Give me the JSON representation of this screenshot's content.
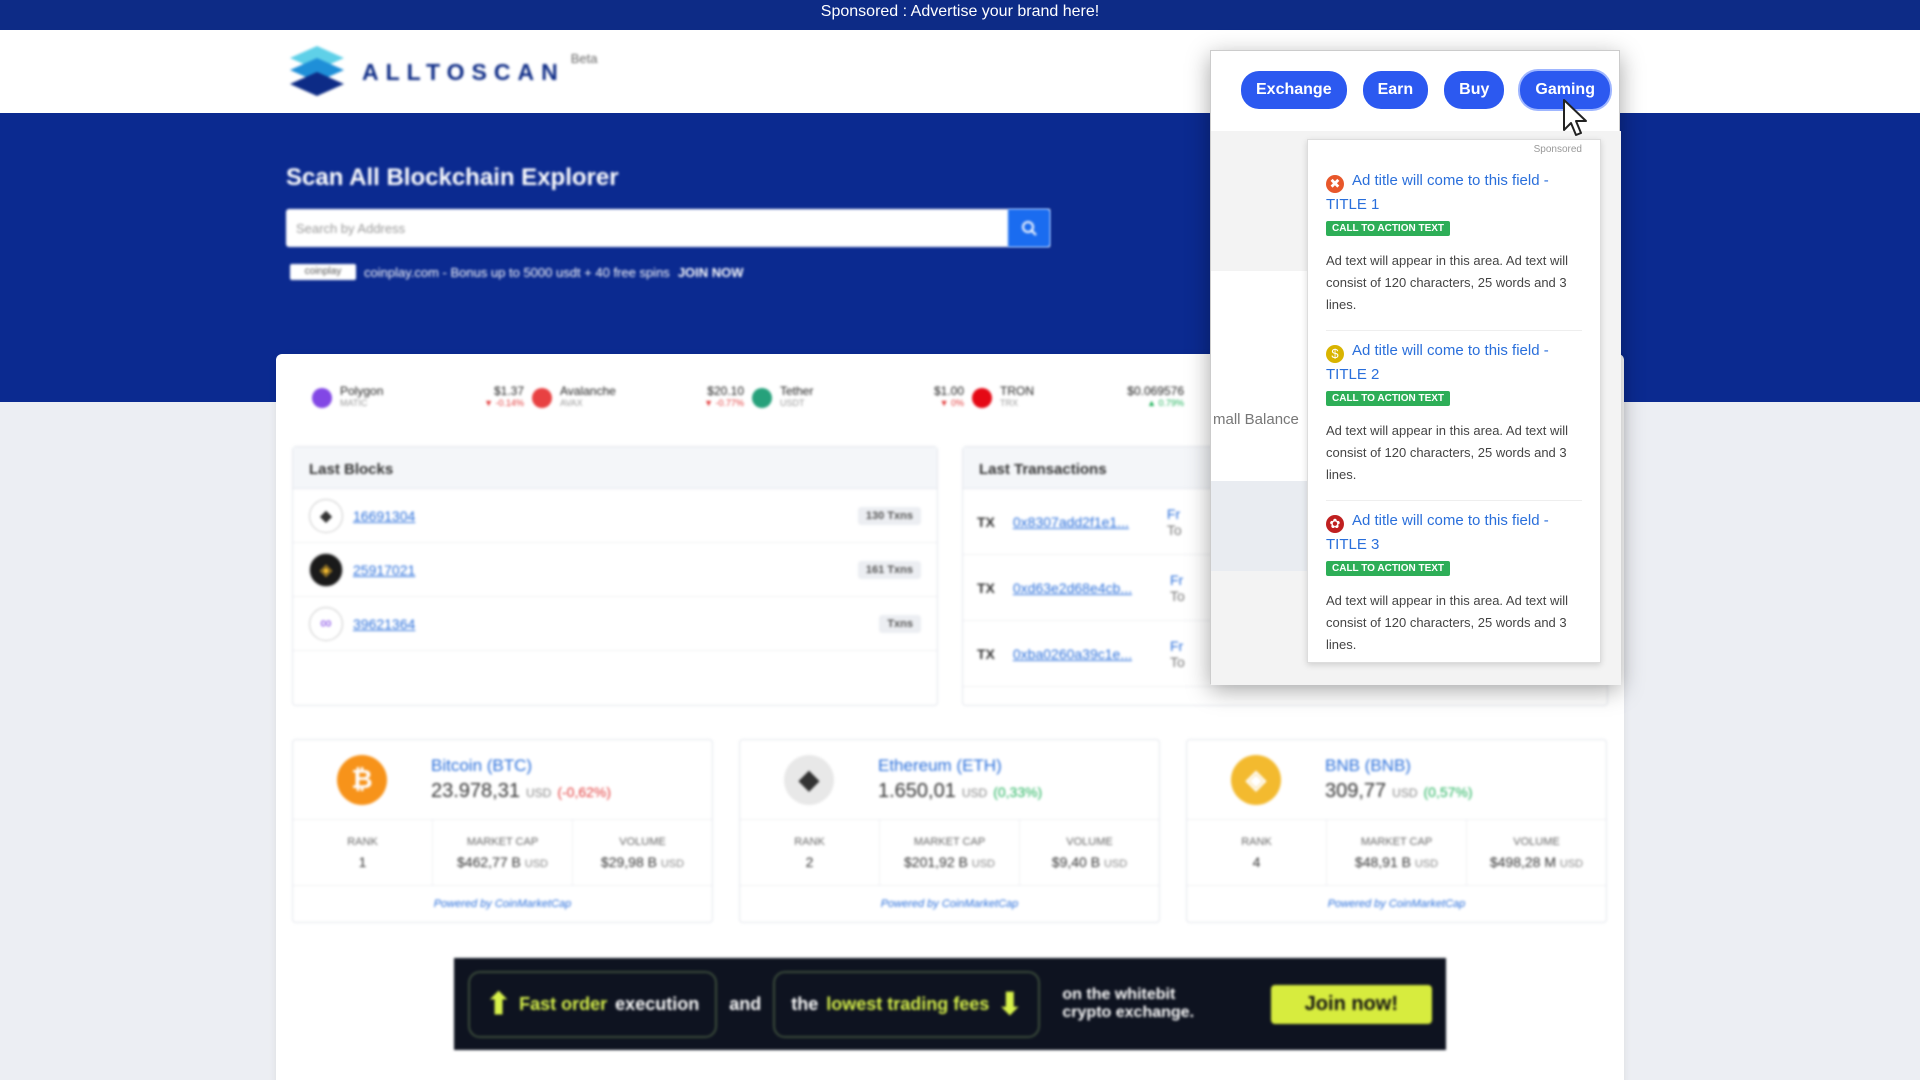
{
  "topbar": {
    "text": "Sponsored :  Advertise your brand here!"
  },
  "logo": {
    "text": "ALLTOSCAN",
    "beta": "Beta"
  },
  "hero": {
    "title": "Scan All Blockchain Explorer",
    "search_placeholder": "Search by Address",
    "promo_logo": "coinplay",
    "promo_text": "coinplay.com - Bonus up to 5000 usdt + 40 free spins",
    "promo_cta": "JOIN NOW"
  },
  "ticker": [
    {
      "name": "Polygon",
      "symbol": "MATIC",
      "price": "$1.37",
      "change": "▼ -0.14%",
      "color": "#8247e5",
      "dir": "down"
    },
    {
      "name": "Avalanche",
      "symbol": "AVAX",
      "price": "$20.10",
      "change": "▼ -0.77%",
      "color": "#e84142",
      "dir": "down"
    },
    {
      "name": "Tether",
      "symbol": "USDT",
      "price": "$1.00",
      "change": "▼ 0%",
      "color": "#26a17b",
      "dir": "down"
    },
    {
      "name": "TRON",
      "symbol": "TRX",
      "price": "$0.069576",
      "change": "▲ 0.79%",
      "color": "#e50915",
      "dir": "up"
    }
  ],
  "last_blocks": {
    "title": "Last Blocks",
    "rows": [
      {
        "block": "16691304",
        "txns": "130 Txns",
        "coin": "ethereum-icon"
      },
      {
        "block": "25917021",
        "txns": "161 Txns",
        "coin": "bnb-icon"
      },
      {
        "block": "39621364",
        "txns": "Txns",
        "coin": "polygon-icon"
      }
    ]
  },
  "last_transactions": {
    "title": "Last Transactions",
    "rows": [
      {
        "label": "TX",
        "hash": "0x8307add2f1e1...",
        "from": "Fr",
        "to": "To"
      },
      {
        "label": "TX",
        "hash": "0xd63e2d68e4cb...",
        "from": "Fr",
        "to": "To"
      },
      {
        "label": "TX",
        "hash": "0xba0260a39c1e...",
        "from": "Fr",
        "to": "To"
      }
    ]
  },
  "coins": [
    {
      "name": "Bitcoin (BTC)",
      "price": "23.978,31",
      "unit": "USD",
      "change": "(-0,62%)",
      "dir": "down",
      "rank_label": "RANK",
      "rank": "1",
      "mcap_label": "MARKET CAP",
      "mcap": "$462,77 B",
      "vol_label": "VOLUME",
      "vol": "$29,98 B",
      "powered": "Powered by CoinMarketCap",
      "color": "#f7931a",
      "glyph": "₿"
    },
    {
      "name": "Ethereum (ETH)",
      "price": "1.650,01",
      "unit": "USD",
      "change": "(0,33%)",
      "dir": "up",
      "rank_label": "RANK",
      "rank": "2",
      "mcap_label": "MARKET CAP",
      "mcap": "$201,92 B",
      "vol_label": "VOLUME",
      "vol": "$9,40 B",
      "powered": "Powered by CoinMarketCap",
      "color": "#e8e8e8",
      "glyph": "◆"
    },
    {
      "name": "BNB (BNB)",
      "price": "309,77",
      "unit": "USD",
      "change": "(0,57%)",
      "dir": "up",
      "rank_label": "RANK",
      "rank": "4",
      "mcap_label": "MARKET CAP",
      "mcap": "$48,91 B",
      "vol_label": "VOLUME",
      "vol": "$498,28 M",
      "powered": "Powered by CoinMarketCap",
      "color": "#f3ba2f",
      "glyph": "◈"
    }
  ],
  "coin_units": {
    "usd": "USD"
  },
  "banner": {
    "part1_hl": "Fast order",
    "part1": "execution",
    "and": "and",
    "part2_pre": "the",
    "part2_hl": "lowest trading fees",
    "tail1": "on the",
    "brand": "whitebit",
    "tail2": "crypto exchange.",
    "cta": "Join now!"
  },
  "popup": {
    "buttons": [
      "Exchange",
      "Earn",
      "Buy",
      "Gaming"
    ],
    "active_button": "Gaming",
    "side_text": "mall Balance",
    "sponsored": "Sponsored",
    "ads": [
      {
        "title": "Ad title will come to this field - TITLE 1",
        "cta": "CALL TO ACTION TEXT",
        "desc": "Ad text will appear in this area. Ad text will consist of 120 characters, 25 words and 3 lines.",
        "icon": "x-icon",
        "icon_color": "#e8572a",
        "glyph": "✖"
      },
      {
        "title": "Ad title will come to this field - TITLE 2",
        "cta": "CALL TO ACTION TEXT",
        "desc": "Ad text will appear in this area. Ad text will consist of 120 characters, 25 words and 3 lines.",
        "icon": "dollar-coin-icon",
        "icon_color": "#d9b400",
        "glyph": "$"
      },
      {
        "title": "Ad title will come to this field - TITLE 3",
        "cta": "CALL TO ACTION TEXT",
        "desc": "Ad text will appear in this area. Ad text will consist of 120 characters, 25 words and 3 lines.",
        "icon": "gear-coin-icon",
        "icon_color": "#c02020",
        "glyph": "✿"
      }
    ]
  }
}
